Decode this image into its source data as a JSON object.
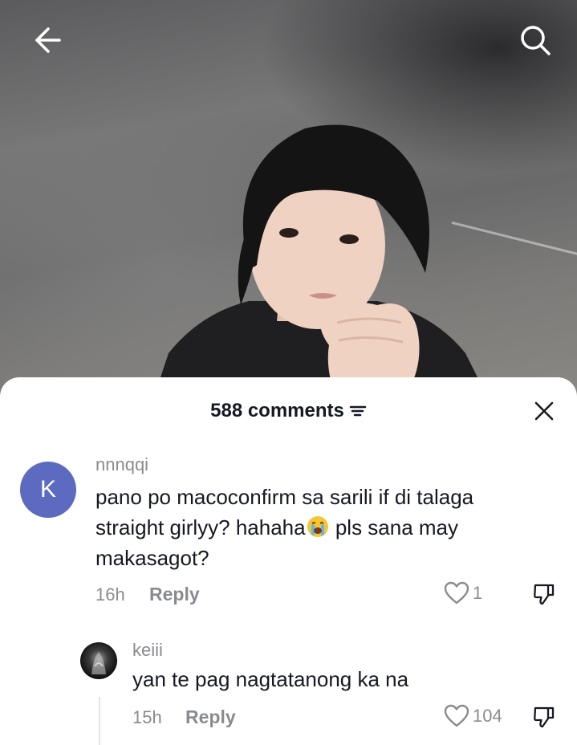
{
  "top_bar": {
    "back_icon": "arrow-left-icon",
    "search_icon": "search-icon"
  },
  "sheet": {
    "comment_count": "588 comments",
    "filter_icon": "sort-filter-icon",
    "close_icon": "close-icon"
  },
  "comments": [
    {
      "avatar_letter": "K",
      "avatar_color": "#5c6bc0",
      "username": "nnnqqi",
      "text_line1": "pano po macoconfirm sa sarili if di talaga",
      "text_line2_before": "straight girlyy? hahaha",
      "text_line2_emoji": "loudly-crying-face-emoji",
      "text_line2_after": " pls sana may",
      "text_line3": "makasagot?",
      "time": "16h",
      "reply_label": "Reply",
      "likes": "1"
    }
  ],
  "replies": [
    {
      "username": "keiii",
      "text": "yan te pag nagtatanong ka na",
      "time": "15h",
      "reply_label": "Reply",
      "likes": "104"
    }
  ]
}
